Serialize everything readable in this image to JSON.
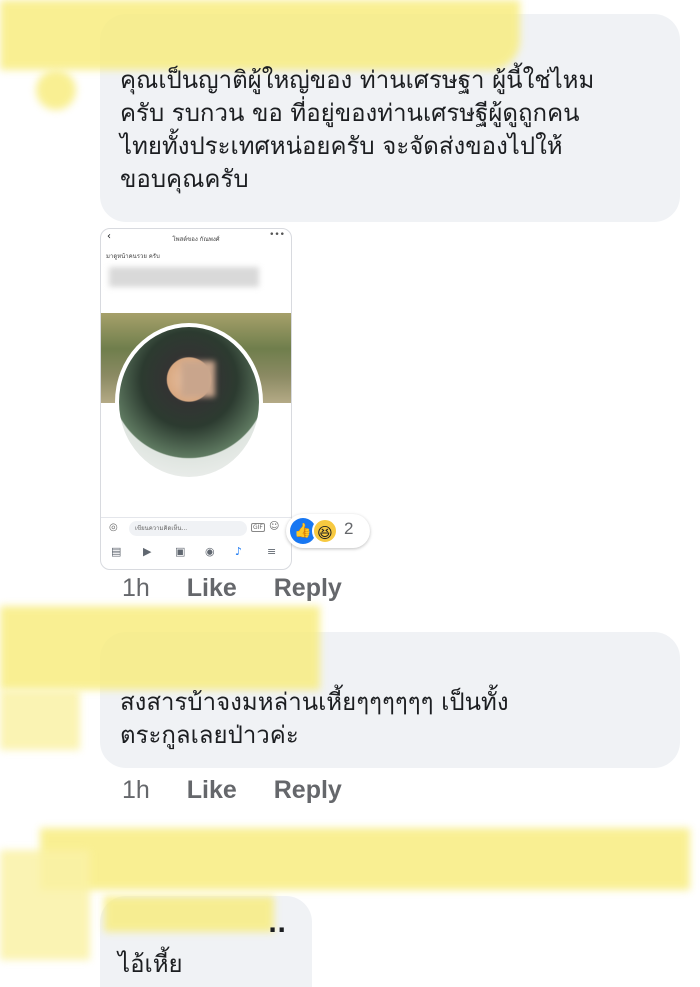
{
  "comments": [
    {
      "text": "คุณเป็นญาติผู้ใหญ่ของ ท่านเศรษฐา ผู้นี้ใช่ไหม\nครับ รบกวน ขอ ที่อยู่ของท่านเศรษฐีผู้ดูถูกคน\nไทยทั้งประเทศหน่อยครับ จะจัดส่งของไปให้\nขอบคุณครับ",
      "time": "1h",
      "like": "Like",
      "reply": "Reply",
      "reaction_count": "2",
      "reaction_icons": [
        "like-icon",
        "haha-icon"
      ],
      "shared_post": {
        "title": "โพสต์ของ กัณพงศ์",
        "caption": "มาดูหน้าคนรวย ครับ",
        "comment_placeholder": "เขียนความคิดเห็น...",
        "gif_label": "GIF"
      }
    },
    {
      "text": "สงสารบ้าจงมหล่านเหี้ยๆๆๆๆๆๆ เป็นทั้ง\nตระกูลเลยป่าวค่ะ",
      "time": "1h",
      "like": "Like",
      "reply": "Reply"
    },
    {
      "name_suffix": "..",
      "text": "ไอ้เหี้ย"
    }
  ]
}
